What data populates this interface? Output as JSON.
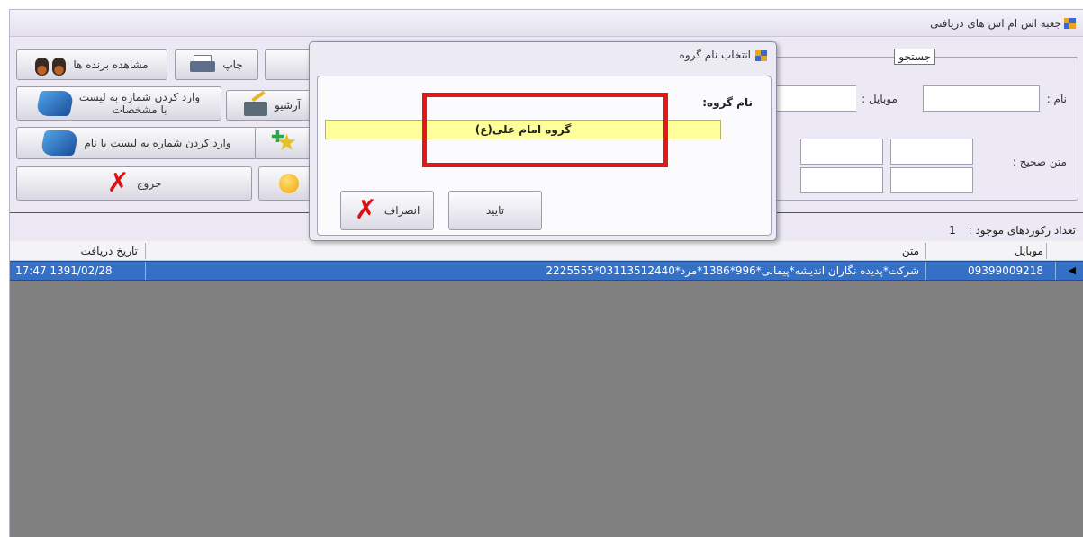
{
  "window": {
    "title": "جعبه اس ام اس های دریافتی"
  },
  "toolbar": {
    "view_winners": "مشاهده برنده ها",
    "print": "چاپ",
    "archive": "آرشیو",
    "add_numbers_with_details_line1": "وارد کردن شماره به لیست",
    "add_numbers_with_details_line2": "با مشخصات",
    "add_numbers_with_name": "وارد کردن شماره به لیست با نام",
    "exit": "خروج"
  },
  "search": {
    "legend": "جستجو",
    "name_label": "نام :",
    "mobile_label": "موبایل :",
    "correct_text_label": "متن صحیح :"
  },
  "status": {
    "record_count_label": "تعداد رکوردهای موجود :",
    "record_count": "1"
  },
  "grid": {
    "columns": {
      "mobile": "موبایل",
      "text": "متن",
      "date": "تاریخ دریافت"
    },
    "rows": [
      {
        "mobile": "09399009218",
        "text": "شرکت*پدیده نگاران اندیشه*پیمانی*996*1386*مرد*03113512440*2225555",
        "date": "17:47 1391/02/28"
      }
    ]
  },
  "dialog": {
    "title": "انتخاب نام گروه",
    "group_label": "نام گروه:",
    "group_value": "گروه امام علی(ع)",
    "confirm": "تایید",
    "cancel": "انصراف"
  },
  "colors": {
    "selection": "#3470c6",
    "highlight": "#e11919",
    "input_bg": "#ffff99"
  }
}
